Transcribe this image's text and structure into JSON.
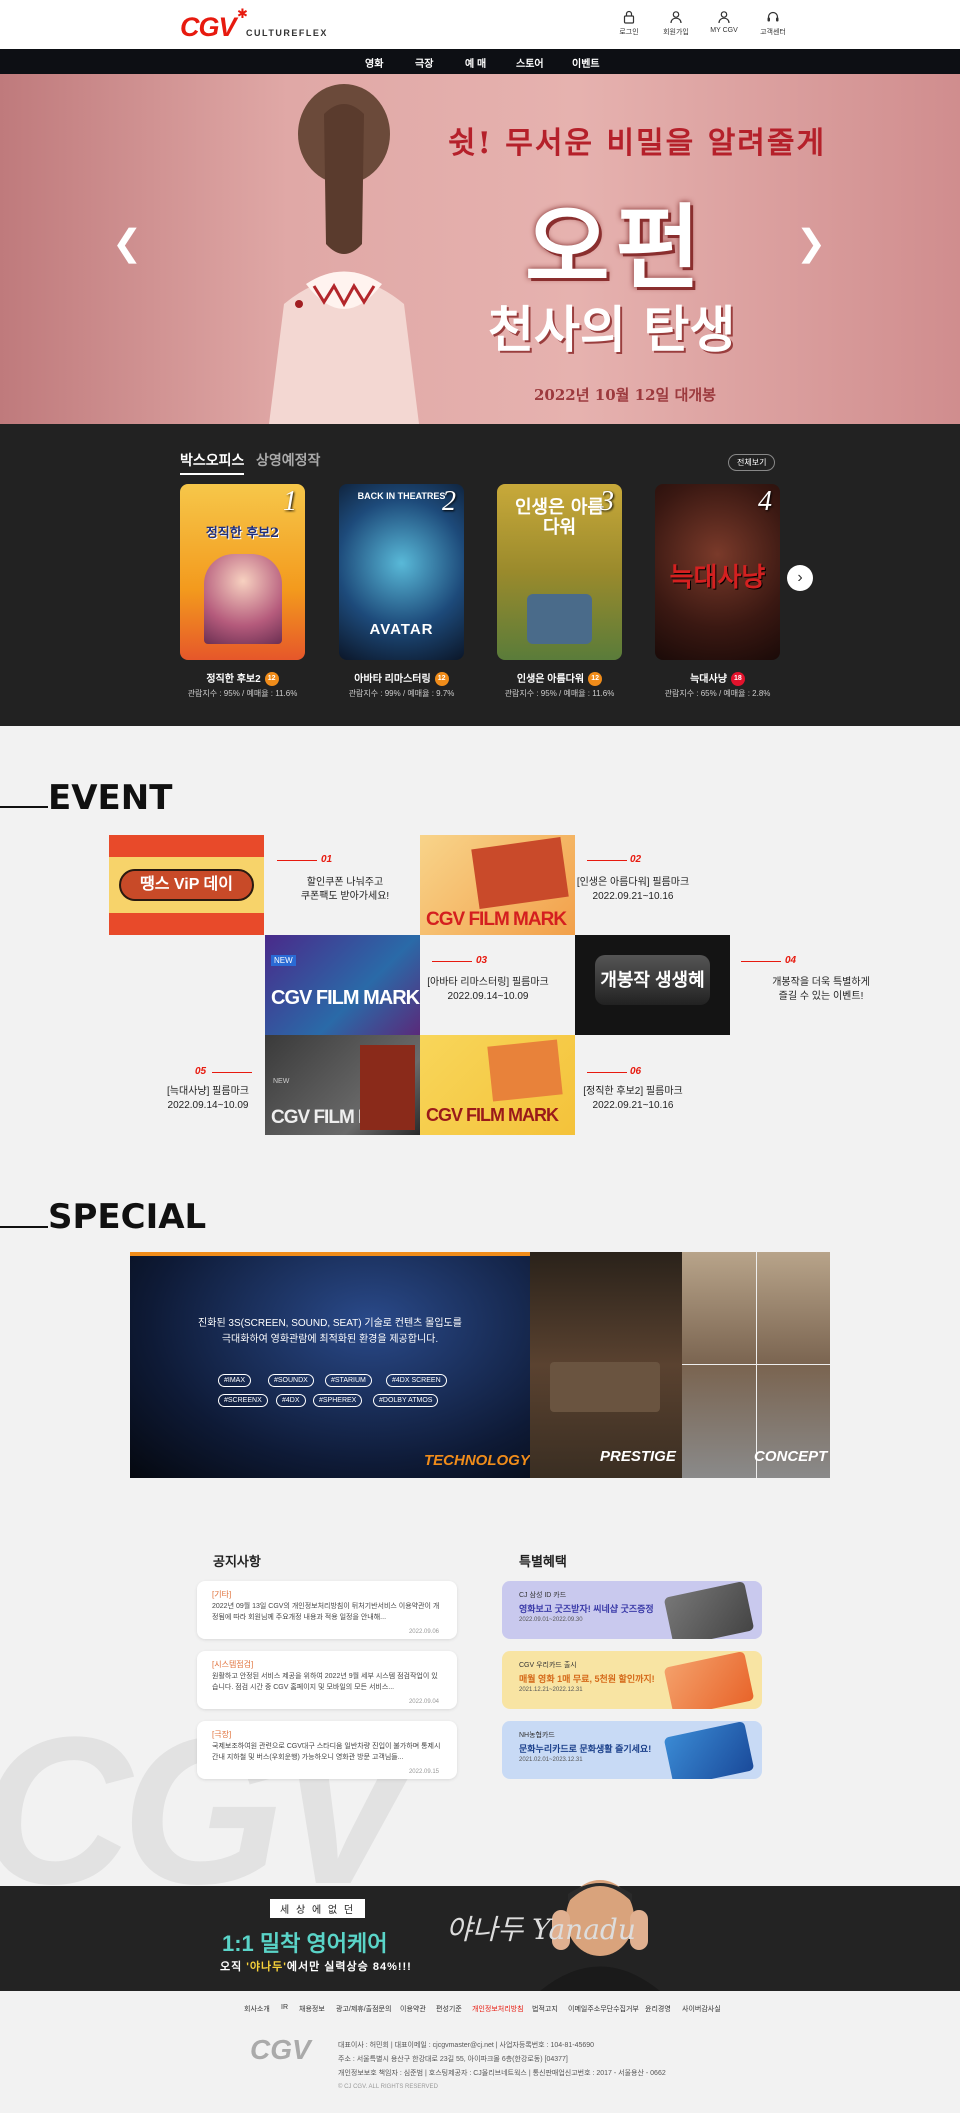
{
  "header": {
    "logo_text": "CGV",
    "logo_sub": "CULTUREFLEX",
    "user_menu": [
      {
        "label": "로그인"
      },
      {
        "label": "회원가입"
      },
      {
        "label": "MY CGV"
      },
      {
        "label": "고객센터"
      }
    ]
  },
  "nav": [
    {
      "label": "영화"
    },
    {
      "label": "극장"
    },
    {
      "label": "예 매"
    },
    {
      "label": "스토어"
    },
    {
      "label": "이벤트"
    }
  ],
  "hero": {
    "tagline": "쉿! 무서운 비밀을 알려줄게",
    "title": "오펀",
    "subtitle": "천사의 탄생",
    "release": "2022년 10월 12일 대개봉"
  },
  "boxoffice": {
    "tabs": [
      {
        "label": "박스오피스"
      },
      {
        "label": "상영예정작"
      }
    ],
    "view_all": "전체보기",
    "movies": [
      {
        "rank": "1",
        "poster_title": "정직한 후보2",
        "title": "정직한 후보2",
        "age": "12",
        "stats": "관람지수 : 95% / 예매율 : 11.6%"
      },
      {
        "rank": "2",
        "poster_tag": "BACK IN THEATRES",
        "poster_title": "AVATAR",
        "title": "아바타 리마스터링",
        "age": "12",
        "stats": "관람지수 : 99% / 예매율 : 9.7%"
      },
      {
        "rank": "3",
        "poster_title": "인생은 아름다워",
        "title": "인생은 아름다워",
        "age": "12",
        "stats": "관람지수 : 95% / 예매율 : 11.6%"
      },
      {
        "rank": "4",
        "poster_title": "늑대사냥",
        "title": "늑대사냥",
        "age": "18",
        "stats": "관람지수 : 65% / 예매율 : 2.8%"
      }
    ]
  },
  "event": {
    "title": "EVENT",
    "items": [
      {
        "num": "01",
        "text1": "할인쿠폰 나눠주고",
        "text2": "쿠폰팩도 받아가세요!",
        "thumb": "땡스 ViP 데이"
      },
      {
        "num": "02",
        "text1": "[인생은 아름다워] 필름마크",
        "text2": "2022.09.21~10.16",
        "thumb": "CGV FILM MARK"
      },
      {
        "num": "03",
        "text1": "[아바타 리마스터링] 필름마크",
        "text2": "2022.09.14~10.09",
        "thumb": "CGV FILM MARK"
      },
      {
        "num": "04",
        "text1": "개봉작을 더욱 특별하게",
        "text2": "즐길 수 있는 이벤트!",
        "thumb": "개봉작 생생혜"
      },
      {
        "num": "05",
        "text1": "[늑대사냥] 필름마크",
        "text2": "2022.09.14~10.09",
        "thumb": "CGV FILM MARK"
      },
      {
        "num": "06",
        "text1": "[정직한 후보2] 필름마크",
        "text2": "2022.09.21~10.16",
        "thumb": "CGV FILM MARK"
      }
    ],
    "new_badge": "NEW",
    "filmmark_small": "필름마크"
  },
  "special": {
    "title": "SPECIAL",
    "desc1": "진화된 3S(SCREEN, SOUND, SEAT) 기술로 컨텐츠 몰입도를",
    "desc2": "극대화하여 영화관람에 최적화된 환경을 제공합니다.",
    "tags_row1": [
      "#IMAX",
      "#SOUNDX",
      "#STARIUM",
      "#4DX SCREEN"
    ],
    "tags_row2": [
      "#SCREENX",
      "#4DX",
      "#SPHEREX",
      "#DOLBY ATMOS"
    ],
    "labels": {
      "technology": "TECHNOLOGY",
      "prestige": "PRESTIGE",
      "concept": "CONCEPT"
    }
  },
  "notices": {
    "title": "공지사항",
    "items": [
      {
        "cat": "[기타]",
        "text": "2022년 09월 13일 CGV의 개인정보처리방침이 뒤처기반서비스 이용약관이 개정됨에 따라 회원님께 주요개정 내용과 적용 일정을 안내해...",
        "date": "2022.09.06"
      },
      {
        "cat": "[시스템점검]",
        "text": "원활하고 안정된 서비스 제공을 위하여 2022년 9월 세부 시스템 점검작업이 있습니다. 점검 시간 중 CGV 홈페이지 및 모바일의 모든 서비스...",
        "date": "2022.09.04"
      },
      {
        "cat": "[극장]",
        "text": "국제보조하여원 관련으로 CGV대구 스타디움 일반차량 진입이 불가하며 통제시간내 지하철 및 버스(우회운행) 가능하오니 영화관 방문 고객님들...",
        "date": "2022.09.15"
      }
    ]
  },
  "benefits": {
    "title": "특별혜택",
    "items": [
      {
        "line1": "CJ 삼성 ID 카드",
        "line2": "영화보고 굿즈받자! 씨네샵 굿즈증정",
        "line3": "2022.09.01~2022.09.30",
        "bg": "#c9c9ee",
        "color": "#3a3aa8"
      },
      {
        "line1": "CGV 우리카드 출시",
        "line2": "매월 영화 1매 무료, 5천원 할인까지!",
        "line3": "2021.12.21~2022.12.31",
        "bg": "#f8e4a3",
        "color": "#d56a1a"
      },
      {
        "line1": "NH농협카드",
        "line2": "문화누리카드로 문화생활 즐기세요!",
        "line3": "2021.02.01~2023.12.31",
        "bg": "#c8daf5",
        "color": "#1a3f8a"
      }
    ]
  },
  "ad": {
    "top": "세 상 에 없 던",
    "headline": "1:1 밀착 영어케어",
    "sub_prefix": "오직 ",
    "sub_brand": "'야나두'",
    "sub_suffix": "에서만 실력상승 84%!!!",
    "script": "야나두 Yanadu"
  },
  "footer": {
    "links": [
      "회사소개",
      "IR",
      "채용정보",
      "광고/제휴/출점문의",
      "이용약관",
      "편성기준",
      "개인정보처리방침",
      "법적고지",
      "이메일주소무단수집거부",
      "윤리경영",
      "사이버감사실"
    ],
    "logo": "CGV",
    "info1": "대표이사 : 허민회   |   대표이메일 : cjcgvmaster@cj.net   |   사업자등록번호 : 104-81-45690",
    "info2": "주소 : 서울특별시 용산구 한강대로 23길 55, 아이파크몰 6층(한강로동)  [04377]",
    "info3": "개인정보보호 책임자 : 심준범   |   호스팅제공자 : CJ올리브네트웍스   |   통신판매업신고번호 : 2017 - 서울용산 - 0662",
    "copyright": "© CJ CGV. ALL RIGHTS RESERVED"
  }
}
